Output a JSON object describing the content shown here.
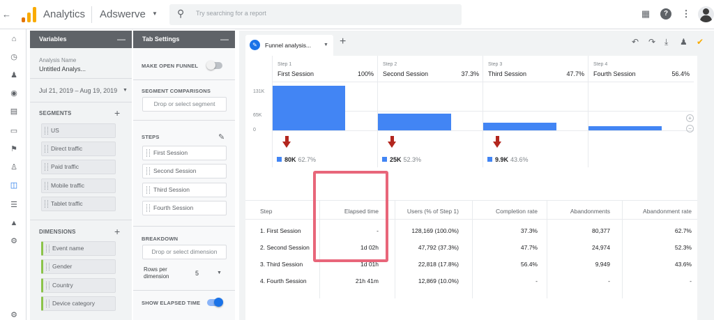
{
  "topbar": {
    "back_icon": "back-arrow-icon",
    "app_name": "Analytics",
    "account": "Adswerve",
    "search_placeholder": "Try searching for a report",
    "icons": [
      "apps-grid-icon",
      "help-icon",
      "more-vert-icon",
      "avatar"
    ],
    "logo_colors": [
      "#f9ab00",
      "#e37400"
    ]
  },
  "rail": {
    "icons": [
      "home-icon",
      "realtime-clock-icon",
      "audience-person-icon",
      "acquisition-globe-icon",
      "behavior-table-icon",
      "devices-icon",
      "flag-icon",
      "person-icon",
      "analysis-icon",
      "user-list-icon",
      "hierarchy-icon",
      "settings-gear-icon",
      "admin-gear-icon"
    ]
  },
  "variables": {
    "title": "Variables",
    "analysis_name_label": "Analysis Name",
    "analysis_name": "Untitled Analys...",
    "date_range": "Jul 21, 2019 – Aug 19, 2019",
    "segments_title": "SEGMENTS",
    "segments": [
      "US",
      "Direct traffic",
      "Paid traffic",
      "Mobile traffic",
      "Tablet traffic"
    ],
    "dimensions_title": "DIMENSIONS",
    "dimensions": [
      "Event name",
      "Gender",
      "Country",
      "Device category"
    ]
  },
  "tab_settings": {
    "title": "Tab Settings",
    "make_open_funnel": "MAKE OPEN FUNNEL",
    "make_open_funnel_on": false,
    "segment_comparisons": "SEGMENT COMPARISONS",
    "segment_drop": "Drop or select segment",
    "steps_title": "STEPS",
    "steps": [
      "First Session",
      "Second Session",
      "Third Session",
      "Fourth Session"
    ],
    "breakdown_title": "BREAKDOWN",
    "breakdown_drop": "Drop or select dimension",
    "rows_per_dimension_label": "Rows per dimension",
    "rows_per_dimension": "5",
    "show_elapsed_time": "SHOW ELAPSED TIME",
    "show_elapsed_time_on": true
  },
  "canvas": {
    "tab_name": "Funnel analysis...",
    "toolbar_icons": [
      "undo-icon",
      "redo-icon",
      "download-icon",
      "share-people-icon",
      "sampling-badge-icon"
    ]
  },
  "chart_data": {
    "type": "bar",
    "categories": [
      "First Session",
      "Second Session",
      "Third Session",
      "Fourth Session"
    ],
    "step_labels": [
      "Step 1",
      "Step 2",
      "Step 3",
      "Step 4"
    ],
    "step_percent": [
      "100%",
      "37.3%",
      "47.7%",
      "56.4%"
    ],
    "values": [
      128169,
      47792,
      22818,
      12869
    ],
    "y_ticks": [
      "131K",
      "65K",
      "0"
    ],
    "ylim": [
      0,
      131000
    ],
    "drop_offs": [
      {
        "value": "80K",
        "pct": "62.7%"
      },
      {
        "value": "25K",
        "pct": "52.3%"
      },
      {
        "value": "9.9K",
        "pct": "43.6%"
      }
    ],
    "bar_color": "#4285f4",
    "arrow_color": "#b3261e"
  },
  "table": {
    "headers": [
      "Step",
      "Elapsed time",
      "Users (% of Step 1)",
      "Completion rate",
      "Abandonments",
      "Abandonment rate"
    ],
    "rows": [
      [
        "1. First Session",
        "-",
        "128,169 (100.0%)",
        "37.3%",
        "80,377",
        "62.7%"
      ],
      [
        "2. Second Session",
        "1d 02h",
        "47,792 (37.3%)",
        "47.7%",
        "24,974",
        "52.3%"
      ],
      [
        "3. Third Session",
        "1d 01h",
        "22,818 (17.8%)",
        "56.4%",
        "9,949",
        "43.6%"
      ],
      [
        "4. Fourth Session",
        "21h 41m",
        "12,869 (10.0%)",
        "-",
        "-",
        "-"
      ]
    ],
    "highlight_color": "#e8667a"
  }
}
